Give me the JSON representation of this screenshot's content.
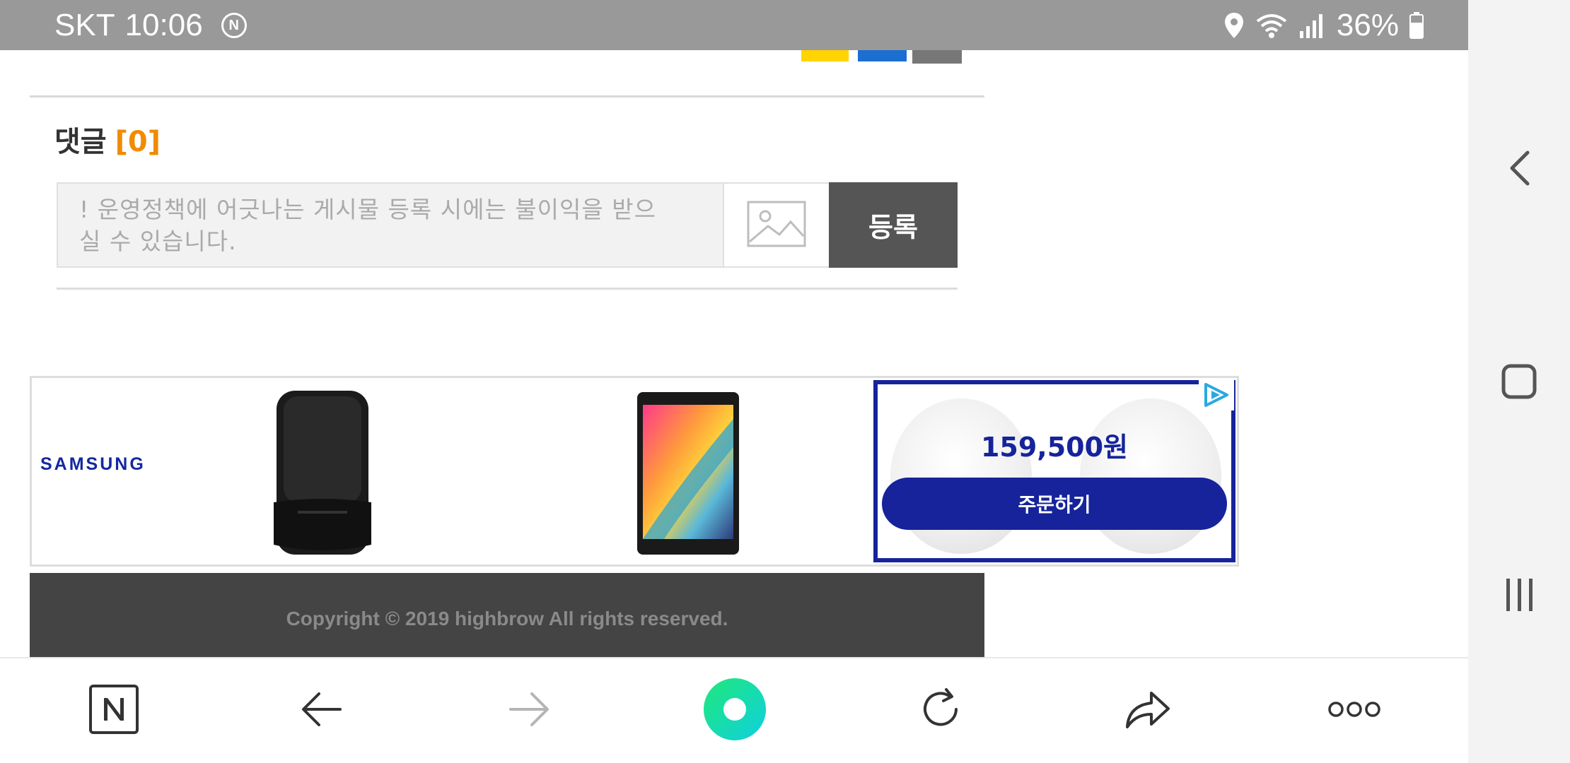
{
  "status_bar": {
    "carrier": "SKT",
    "time": "10:06",
    "notification_letter": "N",
    "battery": "36%",
    "icons": [
      "location-icon",
      "wifi-icon",
      "signal-icon",
      "battery-icon"
    ]
  },
  "comments": {
    "title": "댓글",
    "count": "[0]",
    "placeholder_line1": "! 운영정책에 어긋나는 게시물 등록 시에는 불이익을 받으",
    "placeholder_line2": "실 수 있습니다.",
    "submit_label": "등록"
  },
  "ad": {
    "brand": "SAMSUNG",
    "price": "159,500원",
    "order_label": "주문하기"
  },
  "footer": {
    "copyright": "Copyright © 2019 highbrow All rights reserved."
  },
  "toolbar": {
    "items": [
      "naver-home-icon",
      "back-arrow-icon",
      "forward-arrow-icon",
      "green-dot-icon",
      "refresh-icon",
      "share-icon",
      "more-icon"
    ]
  },
  "colors": {
    "status_bar_bg": "#999999",
    "accent_orange": "#f08b00",
    "samsung_blue": "#16239b",
    "register_btn_bg": "#555555",
    "footer_bg": "#444444"
  }
}
